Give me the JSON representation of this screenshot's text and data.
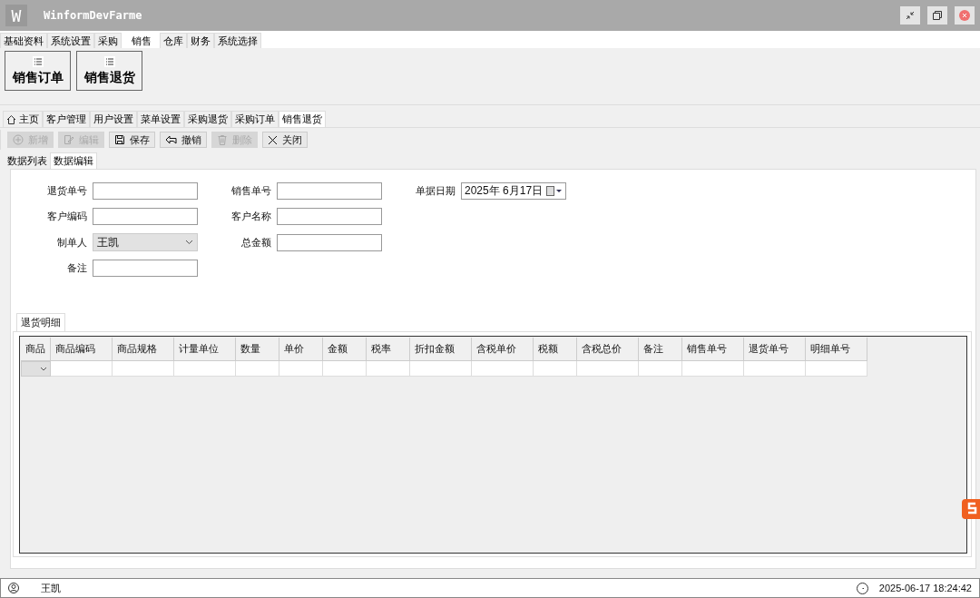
{
  "window": {
    "logo": "W",
    "title": "WinformDevFarme"
  },
  "menu_tabs": [
    {
      "label": "基础资料",
      "selected": false
    },
    {
      "label": "系统设置",
      "selected": false
    },
    {
      "label": "采购",
      "selected": false
    },
    {
      "label": "销售",
      "selected": true
    },
    {
      "label": "仓库",
      "selected": false
    },
    {
      "label": "财务",
      "selected": false
    },
    {
      "label": "系统选择",
      "selected": false
    }
  ],
  "ribbon_buttons": [
    {
      "label": "销售订单"
    },
    {
      "label": "销售退货"
    }
  ],
  "doc_tabs": [
    {
      "label": "主页",
      "kind": "home",
      "selected": false
    },
    {
      "label": "客户管理",
      "kind": "plain",
      "selected": false
    },
    {
      "label": "用户设置",
      "kind": "plain",
      "selected": false
    },
    {
      "label": "菜单设置",
      "kind": "plain",
      "selected": false
    },
    {
      "label": "采购退货",
      "kind": "plain",
      "selected": false
    },
    {
      "label": "采购订单",
      "kind": "plain",
      "selected": false
    },
    {
      "label": "销售退货",
      "kind": "plain",
      "selected": true
    }
  ],
  "toolbar": [
    {
      "label": "新增",
      "kind": "add",
      "disabled": true
    },
    {
      "label": "编辑",
      "kind": "edit",
      "disabled": true
    },
    {
      "label": "保存",
      "kind": "save",
      "disabled": false
    },
    {
      "label": "撤销",
      "kind": "undo",
      "disabled": false
    },
    {
      "label": "删除",
      "kind": "delete",
      "disabled": true
    },
    {
      "label": "关闭",
      "kind": "close",
      "disabled": false
    }
  ],
  "sub_tabs": [
    {
      "label": "数据列表",
      "selected": false
    },
    {
      "label": "数据编辑",
      "selected": true
    }
  ],
  "form": {
    "rows": [
      [
        {
          "label": "退货单号",
          "kind": "text"
        },
        {
          "label": "销售单号",
          "kind": "text"
        },
        {
          "label": "单据日期",
          "kind": "date",
          "value": "2025年  6月17日"
        }
      ],
      [
        {
          "label": "客户编码",
          "kind": "text"
        },
        {
          "label": "客户名称",
          "kind": "text"
        }
      ],
      [
        {
          "label": "制单人",
          "kind": "select",
          "value": "王凯"
        },
        {
          "label": "总金额",
          "kind": "text"
        }
      ],
      [
        {
          "label": "备注",
          "kind": "text"
        }
      ]
    ]
  },
  "detail": {
    "tab": "退货明细",
    "columns": [
      "商品",
      "商品编码",
      "商品规格",
      "计量单位",
      "数量",
      "单价",
      "金额",
      "税率",
      "折扣金额",
      "含税单价",
      "税额",
      "含税总价",
      "备注",
      "销售单号",
      "退货单号",
      "明细单号"
    ]
  },
  "status_bar": {
    "user": "王凯",
    "time": "2025-06-17 18:24:42"
  }
}
